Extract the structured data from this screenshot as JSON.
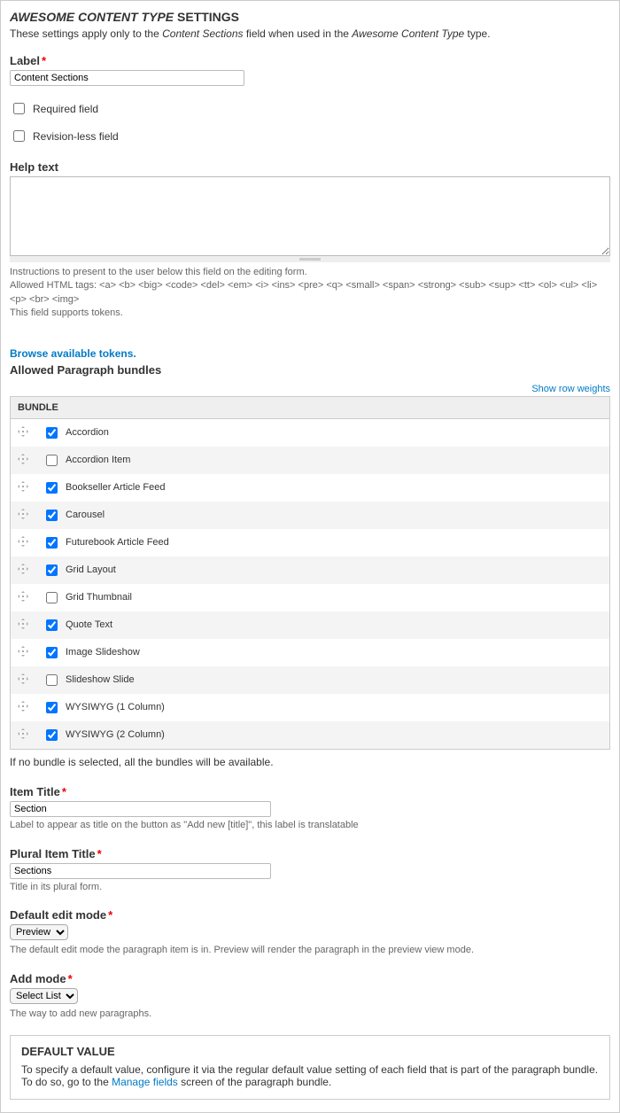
{
  "header": {
    "title_prefix_italic": "AWESOME CONTENT TYPE",
    "title_suffix": " SETTINGS",
    "intro_pre": "These settings apply only to the ",
    "intro_em1": "Content Sections",
    "intro_mid": " field when used in the ",
    "intro_em2": "Awesome Content Type",
    "intro_post": " type."
  },
  "label_field": {
    "label": "Label",
    "value": "Content Sections"
  },
  "required": {
    "label": "Required field",
    "checked": false
  },
  "revisionless": {
    "label": "Revision-less field",
    "checked": false
  },
  "help": {
    "label": "Help text",
    "value": "",
    "desc_line1": "Instructions to present to the user below this field on the editing form.",
    "desc_line2": "Allowed HTML tags: <a> <b> <big> <code> <del> <em> <i> <ins> <pre> <q> <small> <span> <strong> <sub> <sup> <tt> <ol> <ul> <li> <p> <br> <img>",
    "desc_line3": "This field supports tokens."
  },
  "tokens_link": "Browse available tokens.",
  "bundles": {
    "heading": "Allowed Paragraph bundles",
    "show_weights": "Show row weights",
    "col_header": "BUNDLE",
    "rows": [
      {
        "label": "Accordion",
        "checked": true
      },
      {
        "label": "Accordion Item",
        "checked": false
      },
      {
        "label": "Bookseller Article Feed",
        "checked": true
      },
      {
        "label": "Carousel",
        "checked": true
      },
      {
        "label": "Futurebook Article Feed",
        "checked": true
      },
      {
        "label": "Grid Layout",
        "checked": true
      },
      {
        "label": "Grid Thumbnail",
        "checked": false
      },
      {
        "label": "Quote Text",
        "checked": true
      },
      {
        "label": "Image Slideshow",
        "checked": true
      },
      {
        "label": "Slideshow Slide",
        "checked": false
      },
      {
        "label": "WYSIWYG (1 Column)",
        "checked": true
      },
      {
        "label": "WYSIWYG (2 Column)",
        "checked": true
      }
    ],
    "footnote": "If no bundle is selected, all the bundles will be available."
  },
  "item_title": {
    "label": "Item Title",
    "value": "Section",
    "desc": "Label to appear as title on the button as \"Add new [title]\", this label is translatable"
  },
  "plural_item_title": {
    "label": "Plural Item Title",
    "value": "Sections",
    "desc": "Title in its plural form."
  },
  "default_edit_mode": {
    "label": "Default edit mode",
    "value": "Preview",
    "desc": "The default edit mode the paragraph item is in. Preview will render the paragraph in the preview view mode."
  },
  "add_mode": {
    "label": "Add mode",
    "value": "Select List",
    "desc": "The way to add new paragraphs."
  },
  "default_value": {
    "title": "DEFAULT VALUE",
    "text_pre": "To specify a default value, configure it via the regular default value setting of each field that is part of the paragraph bundle. To do so, go to the ",
    "link": "Manage fields",
    "text_post": " screen of the paragraph bundle."
  }
}
